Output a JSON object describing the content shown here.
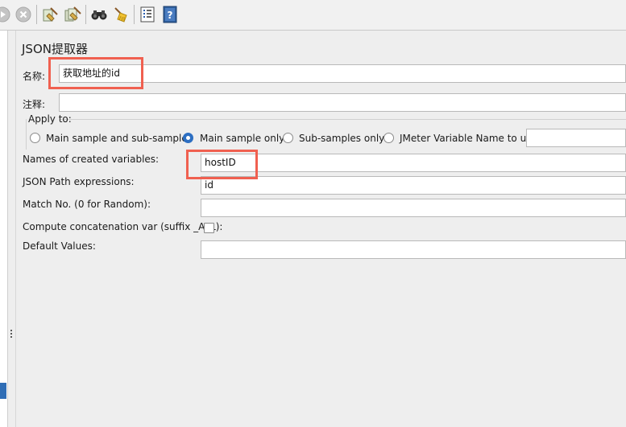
{
  "panel": {
    "title": "JSON提取器",
    "name_label": "名称:",
    "name_value": "获取地址的id",
    "comment_label": "注释:",
    "comment_value": ""
  },
  "apply_to": {
    "label": "Apply to:",
    "options": [
      {
        "label": "Main sample and sub-samples",
        "selected": false
      },
      {
        "label": "Main sample only",
        "selected": true
      },
      {
        "label": "Sub-samples only",
        "selected": false
      },
      {
        "label": "JMeter Variable Name to use",
        "selected": false
      }
    ],
    "variable_value": ""
  },
  "fields": {
    "var_names_label": "Names of created variables:",
    "var_names_value": "hostID",
    "json_path_label": "JSON Path expressions:",
    "json_path_value": "id",
    "match_no_label": "Match No. (0 for Random):",
    "match_no_value": "",
    "concat_label": "Compute concatenation var (suffix _ALL):",
    "concat_checked": false,
    "default_label": "Default Values:",
    "default_value": ""
  },
  "toolbar_icons": [
    "start-no-pauses-icon",
    "stop-icon",
    "clear-icon",
    "clear-all-icon",
    "search-icon",
    "reset-search-icon",
    "function-helper-icon",
    "help-icon"
  ],
  "colors": {
    "highlight": "#f06050",
    "radio_selected": "#2d6fc2",
    "selection": "#2f6db5"
  }
}
